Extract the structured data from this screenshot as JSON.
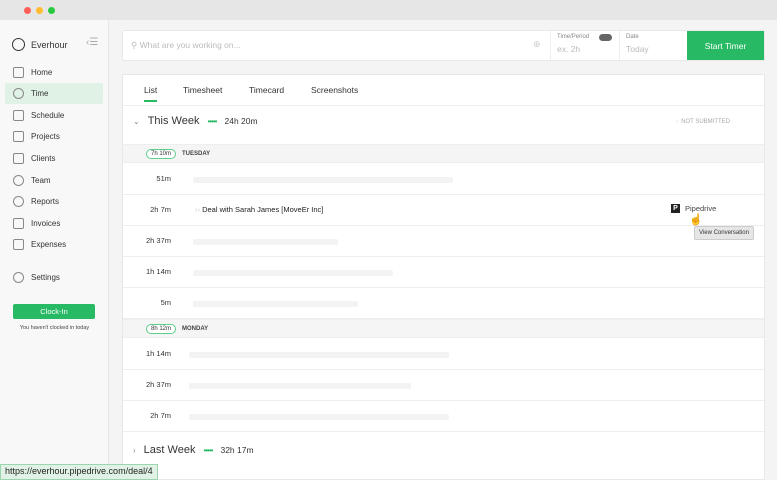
{
  "window": {
    "colors": {
      "close": "#fe5f57",
      "min": "#febc2e",
      "max": "#28c840"
    }
  },
  "sidebar": {
    "brand": "Everhour",
    "items": [
      {
        "label": "Home"
      },
      {
        "label": "Time"
      },
      {
        "label": "Schedule"
      },
      {
        "label": "Projects"
      },
      {
        "label": "Clients"
      },
      {
        "label": "Team"
      },
      {
        "label": "Reports"
      },
      {
        "label": "Invoices"
      },
      {
        "label": "Expenses"
      },
      {
        "label": "Settings"
      }
    ],
    "active": "Time",
    "clock_in": "Clock-In",
    "clock_note": "You haven't clocked in today"
  },
  "topbar": {
    "search_placeholder": "What are you working on...",
    "time_label": "Time/Period",
    "time_placeholder": "ex. 2h",
    "date_label": "Date",
    "date_placeholder": "Today",
    "start_timer": "Start Timer"
  },
  "tabs": [
    {
      "label": "List"
    },
    {
      "label": "Timesheet"
    },
    {
      "label": "Timecard"
    },
    {
      "label": "Screenshots"
    }
  ],
  "this_week": {
    "title": "This Week",
    "total": "24h 20m",
    "status": "NOT SUBMITTED",
    "days": [
      {
        "total": "7h 10m",
        "name": "TUESDAY",
        "rows": [
          {
            "dur": "51m"
          },
          {
            "dur": "2h 7m",
            "task": "Deal with Sarah James [MoveEr Inc]",
            "integration": "Pipedrive",
            "tooltip": "View Conversation"
          },
          {
            "dur": "2h 37m"
          },
          {
            "dur": "1h 14m"
          },
          {
            "dur": "5m"
          }
        ]
      },
      {
        "total": "8h 12m",
        "name": "MONDAY",
        "rows": [
          {
            "dur": "1h 14m"
          },
          {
            "dur": "2h 37m"
          },
          {
            "dur": "2h 7m"
          }
        ]
      }
    ]
  },
  "last_week": {
    "title": "Last Week",
    "total": "32h 17m"
  },
  "statusbar": {
    "url": "https://everhour.pipedrive.com/deal/4"
  },
  "colors": {
    "accent": "#27b964"
  }
}
